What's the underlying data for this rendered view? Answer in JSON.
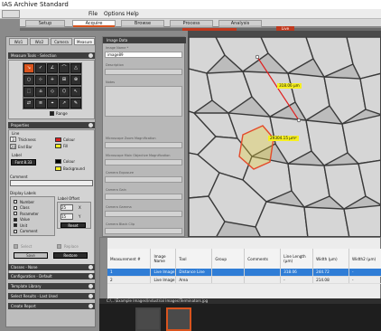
{
  "window": {
    "title": "IAS Archive Standard",
    "menu": [
      "File",
      "Options",
      "Help"
    ]
  },
  "workflow_tabs": [
    {
      "label": "Setup"
    },
    {
      "label": "Acquire",
      "active": true
    },
    {
      "label": "Browse"
    },
    {
      "label": "Process"
    },
    {
      "label": "Analysis"
    }
  ],
  "live_label": "Live",
  "left_tabs": [
    "Wiz1",
    "Wiz2",
    "Camera",
    "Measure"
  ],
  "measure_tools": {
    "title": "Measure Tools - Selection",
    "tools": [
      "↘",
      "✓",
      "∠",
      "⌒",
      "△",
      "○",
      "⊹",
      "+",
      "⊞",
      "⊕",
      "⬚",
      "⌂",
      "◇",
      "⬡",
      "↖",
      "⇄",
      "≡",
      "⌖",
      "↗",
      "✎"
    ],
    "ruler_label": "Range"
  },
  "properties": {
    "title": "Properties",
    "line": {
      "title": "Line",
      "thickness_label": "Thickness",
      "thickness_value": "3",
      "endbar_label": "End Bar",
      "endbar_value": "20",
      "colour_label": "Colour",
      "fill_label": "Fill",
      "colour_hex": "#e02020",
      "fill_hex": "#f6ef20"
    },
    "label": {
      "title": "Label",
      "font_button": "Font 8.33",
      "colour_label": "Colour",
      "background_label": "Background",
      "colour_hex": "#000000",
      "background_hex": "#f6ef20"
    },
    "comment_label": "Comment",
    "display_labels": {
      "title": "Display Labels",
      "items": [
        "Number",
        "Class",
        "Parameter",
        "Value",
        "Unit",
        "Comment"
      ],
      "checked": [
        false,
        false,
        false,
        true,
        true,
        false
      ]
    },
    "label_offset": {
      "title": "Label Offset",
      "x_value": "25",
      "y_value": "15",
      "x_label": "X",
      "y_label": "Y",
      "reset": "Reset"
    },
    "select_label": "Select",
    "replace_label": "Replace",
    "save_button": "Save",
    "restore_button": "Restore"
  },
  "collapsed_panels": [
    "Classes - None",
    "Configuration - Default",
    "Template Library",
    "Select Results - Last Used",
    "Create Report"
  ],
  "image_data": {
    "title": "Image Data",
    "fields": [
      {
        "label": "Image Name *",
        "value": "image89"
      },
      {
        "label": "Description",
        "value": ""
      },
      {
        "label": "Notes",
        "value": ""
      },
      {
        "label": "Microscope Zoom Magnification",
        "value": ""
      },
      {
        "label": "Microscope Main Objective Magnification",
        "value": ""
      },
      {
        "label": "Camera Exposure",
        "value": ""
      },
      {
        "label": "Camera Gain",
        "value": ""
      },
      {
        "label": "Camera Gamma",
        "value": ""
      },
      {
        "label": "Camera Black Clip",
        "value": ""
      },
      {
        "label": "Camera White Clip",
        "value": ""
      },
      {
        "label": "Camera Image Type",
        "value": ""
      }
    ]
  },
  "viewer": {
    "measure_line_label": "318.06 µm",
    "area_label": "29304.15 µm²"
  },
  "results": {
    "columns": [
      "Measurement #",
      "Image Name",
      "Tool",
      "Group",
      "Comments",
      "Line Length (µm)",
      "Width (µm)",
      "Width2 (µm)"
    ],
    "rows": [
      [
        "1",
        "Live Image",
        "Distance Line",
        "",
        "",
        "318.06",
        "244.72",
        "-"
      ],
      [
        "2",
        "Live Image",
        "Area",
        "",
        "",
        "-",
        "214.08",
        "-"
      ]
    ]
  },
  "file_path": "C:\\...\\Example Images\\Industrial Images\\Terminators.jpg"
}
